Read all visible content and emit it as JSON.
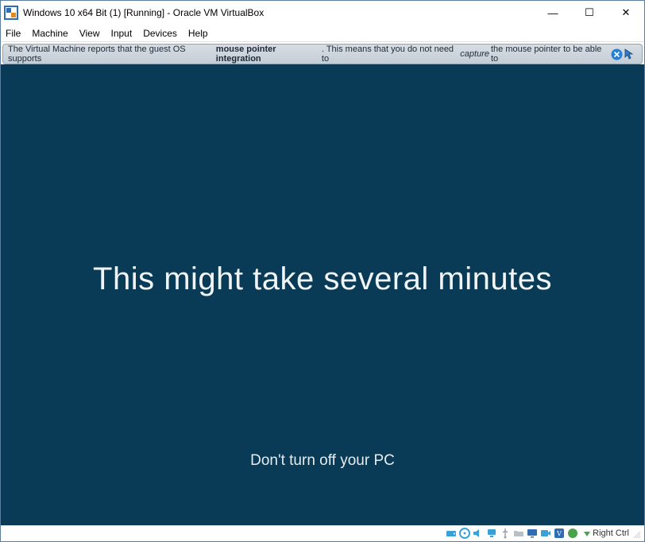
{
  "titlebar": {
    "title": "Windows 10 x64 Bit (1) [Running] - Oracle VM VirtualBox",
    "minimize_glyph": "—",
    "maximize_glyph": "☐",
    "close_glyph": "✕"
  },
  "menubar": {
    "items": [
      "File",
      "Machine",
      "View",
      "Input",
      "Devices",
      "Help"
    ]
  },
  "infobar": {
    "pre": "The Virtual Machine reports that the guest OS supports ",
    "bold": "mouse pointer integration",
    "mid": ". This means that you do not need to ",
    "italic": "capture",
    "post": " the mouse pointer to be able to"
  },
  "guest": {
    "main": "This might take several minutes",
    "sub": "Don't turn off your PC"
  },
  "statusbar": {
    "hostkey": "Right Ctrl"
  }
}
